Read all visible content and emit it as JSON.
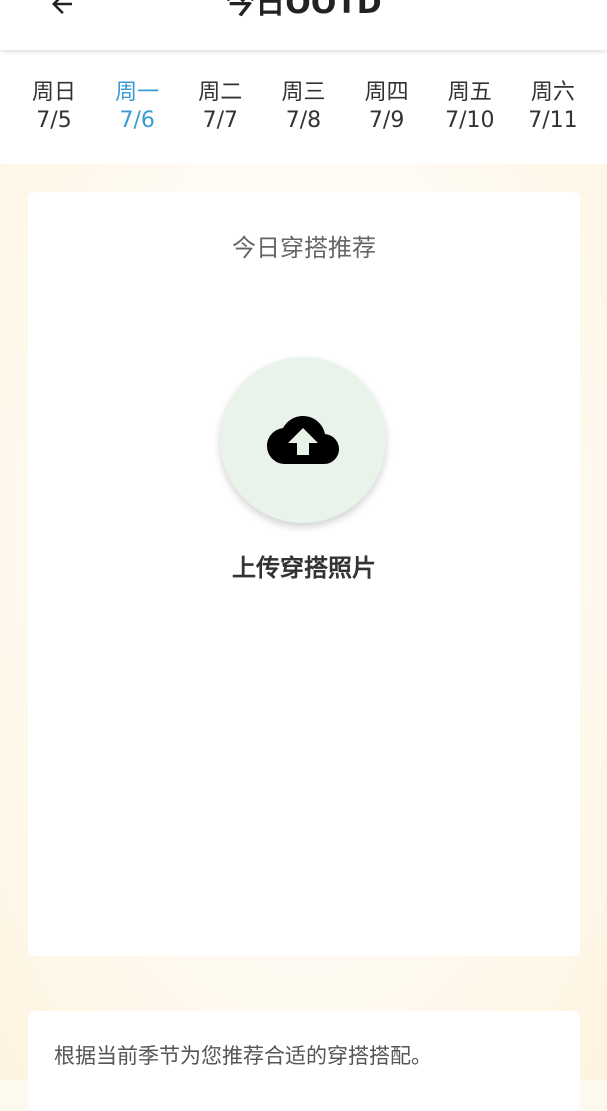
{
  "appbar": {
    "title": "今日OOTD",
    "back_icon": "arrow-left-icon"
  },
  "week": [
    {
      "name": "周日",
      "date": "7/5",
      "selected": false
    },
    {
      "name": "周一",
      "date": "7/6",
      "selected": true
    },
    {
      "name": "周二",
      "date": "7/7",
      "selected": false
    },
    {
      "name": "周三",
      "date": "7/8",
      "selected": false
    },
    {
      "name": "周四",
      "date": "7/9",
      "selected": false
    },
    {
      "name": "周五",
      "date": "7/10",
      "selected": false
    },
    {
      "name": "周六",
      "date": "7/11",
      "selected": false
    }
  ],
  "card": {
    "title": "今日穿搭推荐",
    "upload_icon": "cloud-upload-icon",
    "upload_label": "上传穿搭照片"
  },
  "note": {
    "text": "根据当前季节为您推荐合适的穿搭搭配。"
  },
  "colors": {
    "accent": "#3a9bd5",
    "upload_circle": "#e9f3ea",
    "background": "#fdf9ef"
  }
}
